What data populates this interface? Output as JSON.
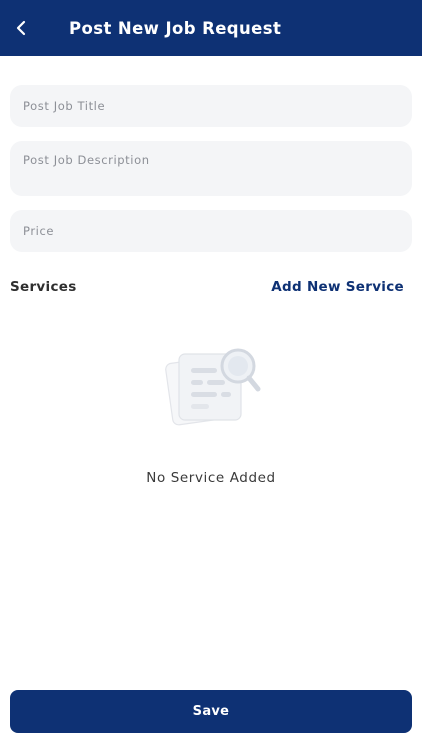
{
  "header": {
    "title": "Post New Job Request",
    "back_icon": "chevron-left-icon"
  },
  "form": {
    "job_title": {
      "placeholder": "Post Job Title",
      "value": ""
    },
    "job_description": {
      "placeholder": "Post Job Description",
      "value": ""
    },
    "price": {
      "placeholder": "Price",
      "value": ""
    }
  },
  "services": {
    "label": "Services",
    "add_label": "Add New Service",
    "empty_icon": "no-results-document-search-icon",
    "empty_text": "No Service Added"
  },
  "footer": {
    "save_label": "Save"
  },
  "colors": {
    "primary": "#0e3174",
    "field_bg": "#f4f5f7",
    "placeholder": "#8c8f96"
  }
}
